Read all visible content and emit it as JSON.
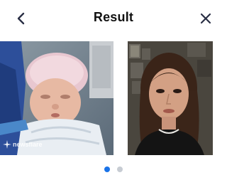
{
  "header": {
    "title": "Result",
    "back_icon": "chevron-left-icon",
    "close_icon": "close-icon"
  },
  "images": {
    "left": {
      "subject": "newborn-baby-photo",
      "watermark": "newsflare"
    },
    "right": {
      "subject": "woman-portrait-photo"
    }
  },
  "pagination": {
    "pages": 2,
    "current": 1,
    "active_color": "#1a73e8",
    "inactive_color": "#c7ccd3"
  },
  "colors": {
    "icon": "#2a2f45",
    "title": "#111111"
  }
}
